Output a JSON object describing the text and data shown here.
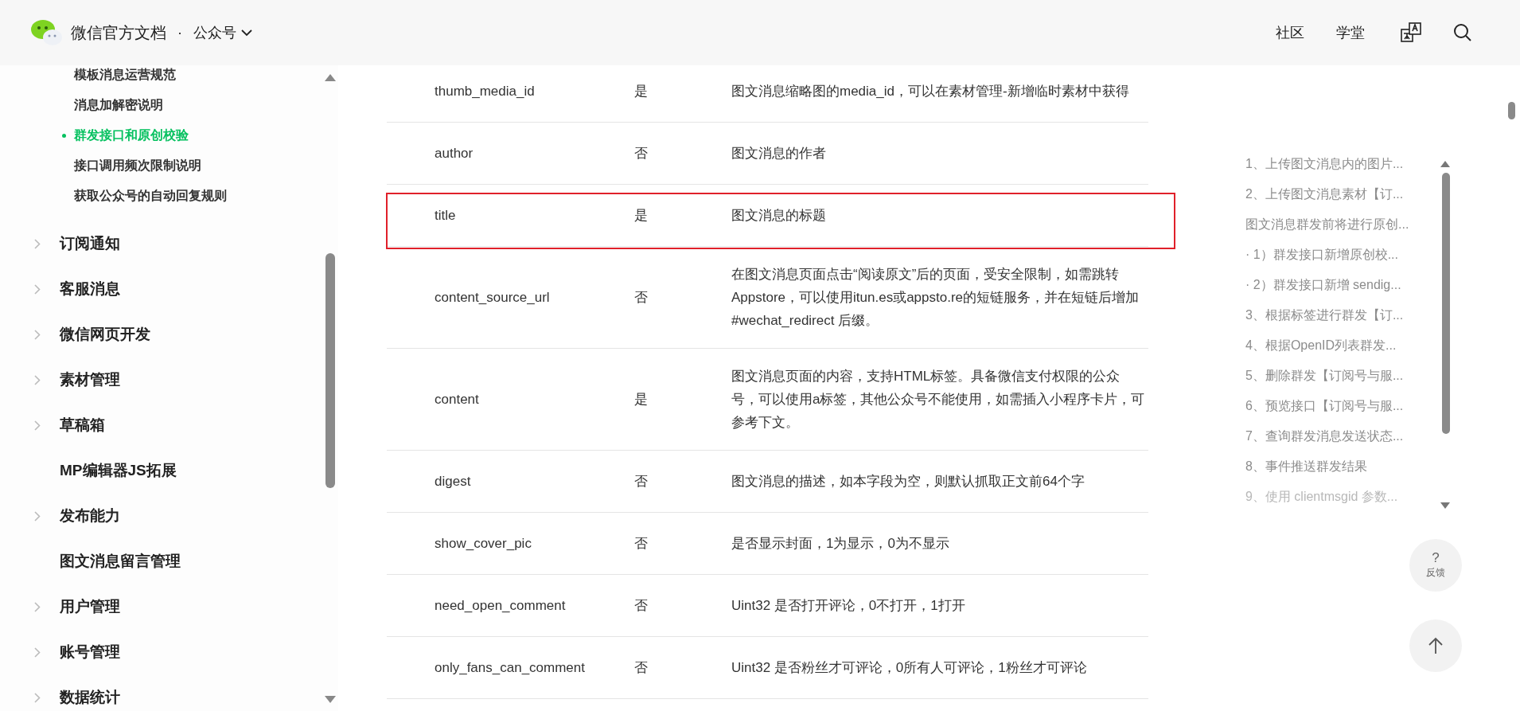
{
  "header": {
    "title": "微信官方文档",
    "separator": "·",
    "section": "公众号",
    "nav": [
      "社区",
      "学堂"
    ]
  },
  "sidebar": {
    "items": [
      {
        "label": "模板消息运营规范",
        "kind": "sub",
        "selected": false
      },
      {
        "label": "消息加解密说明",
        "kind": "sub",
        "selected": false
      },
      {
        "label": "群发接口和原创校验",
        "kind": "sub",
        "selected": true
      },
      {
        "label": "接口调用频次限制说明",
        "kind": "sub",
        "selected": false
      },
      {
        "label": "获取公众号的自动回复规则",
        "kind": "sub",
        "selected": false
      },
      {
        "label": "订阅通知",
        "kind": "top",
        "expandable": true
      },
      {
        "label": "客服消息",
        "kind": "top",
        "expandable": true
      },
      {
        "label": "微信网页开发",
        "kind": "top",
        "expandable": true
      },
      {
        "label": "素材管理",
        "kind": "top",
        "expandable": true
      },
      {
        "label": "草稿箱",
        "kind": "top",
        "expandable": true
      },
      {
        "label": "MP编辑器JS拓展",
        "kind": "top",
        "expandable": false
      },
      {
        "label": "发布能力",
        "kind": "top",
        "expandable": true
      },
      {
        "label": "图文消息留言管理",
        "kind": "top",
        "expandable": false
      },
      {
        "label": "用户管理",
        "kind": "top",
        "expandable": true
      },
      {
        "label": "账号管理",
        "kind": "top",
        "expandable": true
      },
      {
        "label": "数据统计",
        "kind": "top",
        "expandable": true
      }
    ]
  },
  "table": {
    "rows": [
      {
        "name": "thumb_media_id",
        "required": "是",
        "description": "图文消息缩略图的media_id，可以在素材管理-新增临时素材中获得",
        "highlighted": false
      },
      {
        "name": "author",
        "required": "否",
        "description": "图文消息的作者",
        "highlighted": false
      },
      {
        "name": "title",
        "required": "是",
        "description": "图文消息的标题",
        "highlighted": true
      },
      {
        "name": "content_source_url",
        "required": "否",
        "description": "在图文消息页面点击“阅读原文”后的页面，受安全限制，如需跳转Appstore，可以使用itun.es或appsto.re的短链服务，并在短链后增加 #wechat_redirect 后缀。",
        "highlighted": false
      },
      {
        "name": "content",
        "required": "是",
        "description": "图文消息页面的内容，支持HTML标签。具备微信支付权限的公众号，可以使用a标签，其他公众号不能使用，如需插入小程序卡片，可参考下文。",
        "highlighted": false
      },
      {
        "name": "digest",
        "required": "否",
        "description": "图文消息的描述，如本字段为空，则默认抓取正文前64个字",
        "highlighted": false
      },
      {
        "name": "show_cover_pic",
        "required": "否",
        "description": "是否显示封面，1为显示，0为不显示",
        "highlighted": false
      },
      {
        "name": "need_open_comment",
        "required": "否",
        "description": "Uint32 是否打开评论，0不打开，1打开",
        "highlighted": false
      },
      {
        "name": "only_fans_can_comment",
        "required": "否",
        "description": "Uint32 是否粉丝才可评论，0所有人可评论，1粉丝才可评论",
        "highlighted": false
      }
    ]
  },
  "toc": {
    "items": [
      {
        "label": "1、上传图文消息内的图片...",
        "faded": false
      },
      {
        "label": "2、上传图文消息素材【订...",
        "faded": false
      },
      {
        "label": "图文消息群发前将进行原创...",
        "faded": false
      },
      {
        "label": "· 1）群发接口新增原创校...",
        "faded": false
      },
      {
        "label": "· 2）群发接口新增 sendig...",
        "faded": false
      },
      {
        "label": "3、根据标签进行群发【订...",
        "faded": false
      },
      {
        "label": "4、根据OpenID列表群发...",
        "faded": false
      },
      {
        "label": "5、删除群发【订阅号与服...",
        "faded": false
      },
      {
        "label": "6、预览接口【订阅号与服...",
        "faded": false
      },
      {
        "label": "7、查询群发消息发送状态...",
        "faded": false
      },
      {
        "label": "8、事件推送群发结果",
        "faded": false
      },
      {
        "label": "9、使用 clientmsgid 参数...",
        "faded": true
      }
    ]
  },
  "feedback": {
    "symbol": "?",
    "label": "反馈"
  }
}
